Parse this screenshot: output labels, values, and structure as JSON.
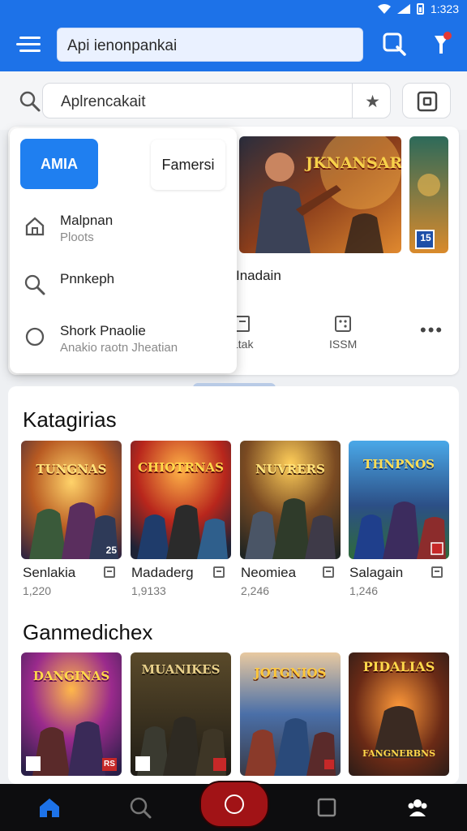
{
  "status_bar": {
    "time": "1:323"
  },
  "app_bar": {
    "search_text": "Api ienonpankai"
  },
  "search_row": {
    "query": "Aplrencakait"
  },
  "dropdown": {
    "chip_primary": "AMIA",
    "chip_secondary": "Famersi",
    "items": [
      {
        "title": "Malpnan",
        "subtitle": "Ploots",
        "icon": "home-icon"
      },
      {
        "title": "Pnnkeph",
        "subtitle": "",
        "icon": "search-icon"
      },
      {
        "title": "Shork Pnaolie",
        "subtitle": "Anakio raotn Jheatian",
        "icon": "circle-icon"
      }
    ]
  },
  "featured": {
    "banner_text": "JKNANSAR",
    "title": "Inadain",
    "actions": [
      {
        "label": "Ltak",
        "icon": "bookmark-icon"
      },
      {
        "label": "ISSM",
        "icon": "dice-icon"
      }
    ],
    "more": "•••",
    "thumb_badge": "15"
  },
  "categories": {
    "title": "Katagirias",
    "items": [
      {
        "art": "TUNGNAS",
        "title": "Senlakia",
        "count": "1,220",
        "corner": "25"
      },
      {
        "art": "CHIOTRNAS",
        "title": "Madaderg",
        "count": "1,9133",
        "corner": ""
      },
      {
        "art": "NUVRERS",
        "title": "Neomiea",
        "count": "2,246",
        "corner": ""
      },
      {
        "art": "THNPNOS",
        "title": "Salagain",
        "count": "1,246",
        "corner": ""
      }
    ]
  },
  "games": {
    "title": "Ganmedichex",
    "items": [
      {
        "art": "DANGINAS",
        "corner": "RS"
      },
      {
        "art": "MUANIKES",
        "corner": ""
      },
      {
        "art": "JOTGNIOS",
        "corner": ""
      },
      {
        "art": "PIDALIAS",
        "corner": "FANGNERBNS"
      }
    ]
  },
  "colors": {
    "primary": "#1d72e8",
    "accent_red": "#a11316"
  }
}
